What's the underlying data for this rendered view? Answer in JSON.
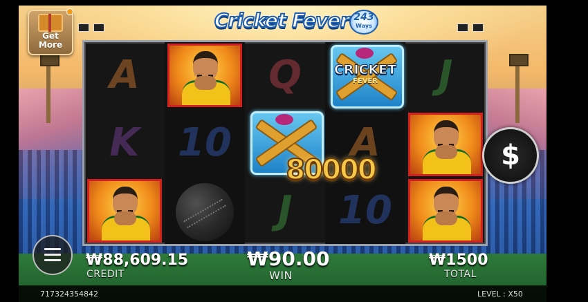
{
  "game": {
    "logo_title": "Cricket Fever",
    "logo_badge_number": "243",
    "logo_badge_word": "Ways"
  },
  "get_more": {
    "line1": "Get",
    "line2": "More"
  },
  "reels": {
    "symbols": {
      "A": "A",
      "K": "K",
      "Q": "Q",
      "J": "J",
      "TEN": "10",
      "wild_line1": "CRICKET",
      "wild_line2": "FEVER"
    },
    "win_amount": "80000"
  },
  "spin_button": {
    "label": "$"
  },
  "balance": {
    "credit_value": "₩88,609.15",
    "credit_label": "CREDIT",
    "win_value": "₩90.00",
    "win_label": "WIN",
    "total_value": "₩1500",
    "total_label": "TOTAL"
  },
  "footer": {
    "round_id": "717324354842",
    "level_label": "LEVEL : X50"
  },
  "colors": {
    "highlight_border": "#d22020",
    "gold": "#f6c84a",
    "reel_bg": "#161616"
  }
}
